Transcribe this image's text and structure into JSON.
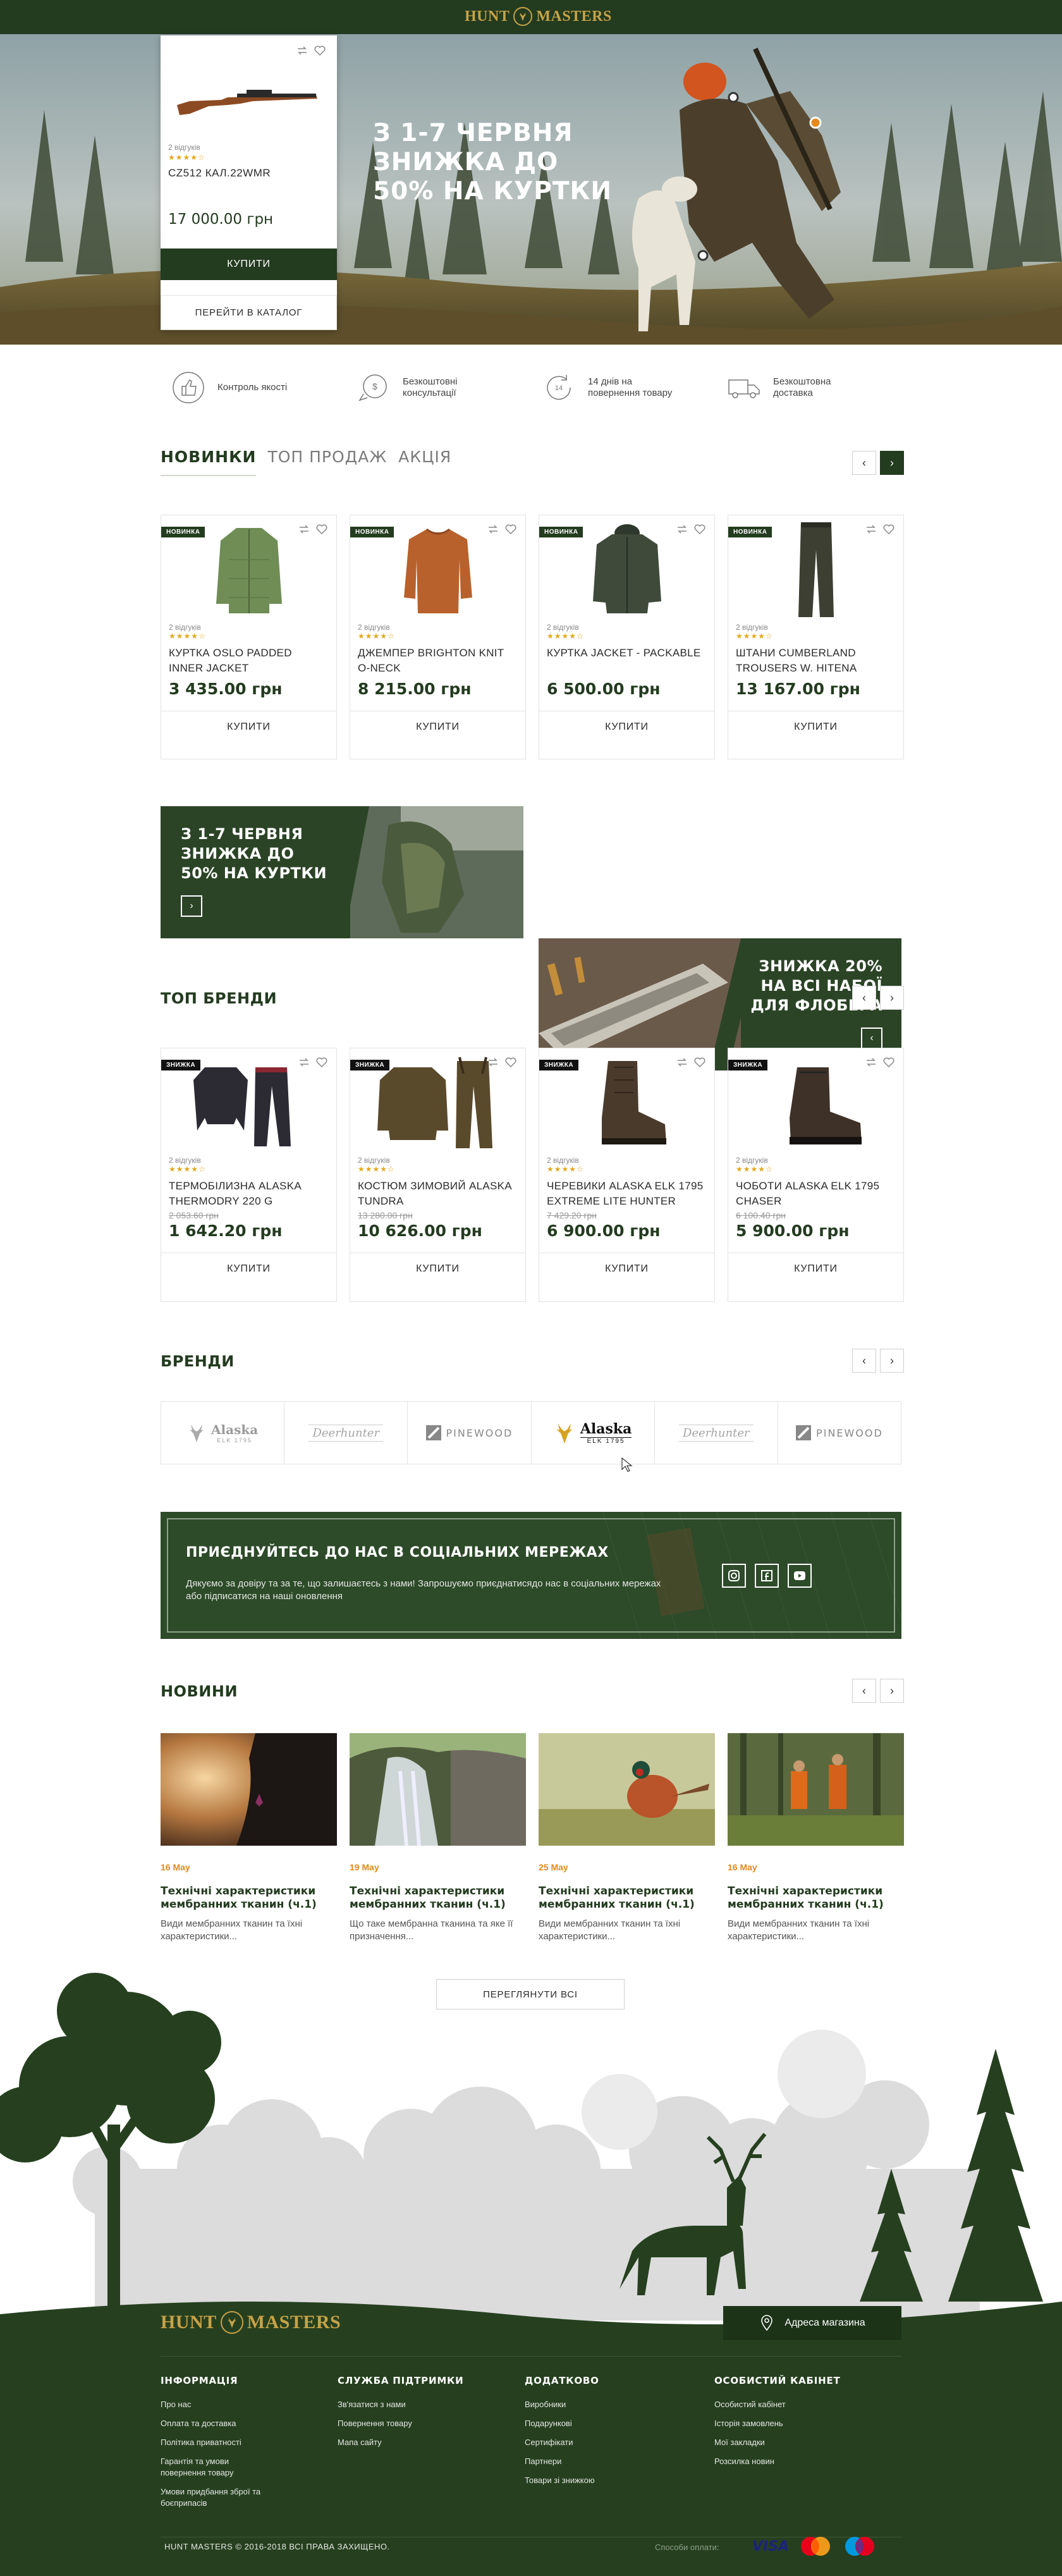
{
  "header": {
    "logo_left": "HUNT",
    "logo_right": "MASTERS"
  },
  "hero": {
    "title_lines": [
      "З 1-7 ЧЕРВНЯ",
      "ЗНИЖКА ДО",
      "50% НА КУРТКИ"
    ],
    "card": {
      "reviews": "2 відгуків",
      "name": "CZ512 КАЛ.22WMR",
      "price": "17 000.00 грн",
      "buy": "КУПИТИ",
      "catalog": "ПЕРЕЙТИ В КАТАЛОГ"
    }
  },
  "features": [
    {
      "icon": "thumbs-up-icon",
      "text": "Контроль якості"
    },
    {
      "icon": "consult-icon",
      "text": "Безкоштовні\nконсультації"
    },
    {
      "icon": "refresh-icon",
      "text": "14 днів на\nповернення товару"
    },
    {
      "icon": "truck-icon",
      "text": "Безкоштовна\nдоставка"
    }
  ],
  "new_section": {
    "tabs": [
      "НОВИНКИ",
      "ТОП ПРОДАЖ",
      "АКЦІЯ"
    ],
    "products": [
      {
        "badge": "НОВИНКА",
        "reviews": "2 відгуків",
        "name": "КУРТКА OSLO PADDED INNER JACKET",
        "price": "3 435.00 грн",
        "buy": "КУПИТИ",
        "color": "#6f8d55"
      },
      {
        "badge": "НОВИНКА",
        "reviews": "2 відгуків",
        "name": "ДЖЕМПЕР BRIGHTON KNIT O-NECK",
        "price": "8 215.00 грн",
        "buy": "КУПИТИ",
        "color": "#b8612c"
      },
      {
        "badge": "НОВИНКА",
        "reviews": "2 відгуків",
        "name": "КУРТКА JACKET - PACKABLE",
        "price": "6 500.00 грн",
        "buy": "КУПИТИ",
        "color": "#3f4a3b"
      },
      {
        "badge": "НОВИНКА",
        "reviews": "2 відгуків",
        "name": "ШТАНИ CUMBERLAND TROUSERS W. HITENA",
        "price": "13 167.00 грн",
        "buy": "КУПИТИ",
        "color": "#3e3f33"
      }
    ]
  },
  "banners": [
    {
      "text_lines": [
        "З 1-7 ЧЕРВНЯ",
        "ЗНИЖКА ДО",
        "50% НА КУРТКИ"
      ]
    },
    {
      "text_lines": [
        "ЗНИЖКА 20%",
        "НА ВСІ НАБОЇ",
        "ДЛЯ ФЛОБЕРА"
      ]
    }
  ],
  "top_brands": {
    "title": "ТОП БРЕНДИ",
    "products": [
      {
        "badge": "ЗНИЖКА",
        "reviews": "2 відгуків",
        "name": "ТЕРМОБІЛИЗНА ALASKA THERMODRY 220 G",
        "old_price": "2 053.60 грн",
        "price": "1 642.20 грн",
        "buy": "КУПИТИ",
        "color": "#2c2a33"
      },
      {
        "badge": "ЗНИЖКА",
        "reviews": "2 відгуків",
        "name": "КОСТЮМ ЗИМОВИЙ ALASKA TUNDRA",
        "old_price": "13 280.00 грн",
        "price": "10 626.00 грн",
        "buy": "КУПИТИ",
        "color": "#5a4a2c"
      },
      {
        "badge": "ЗНИЖКА",
        "reviews": "2 відгуків",
        "name": "ЧЕРЕВИКИ ALASKA ELK 1795 EXTREME LITE HUNTER",
        "old_price": "7 429.20 грн",
        "price": "6 900.00 грн",
        "buy": "КУПИТИ",
        "color": "#4a3a2c"
      },
      {
        "badge": "ЗНИЖКА",
        "reviews": "2 відгуків",
        "name": "ЧОБОТИ ALASKA ELK 1795 CHASER",
        "old_price": "6 100.40 грн",
        "price": "5 900.00 грн",
        "buy": "КУПИТИ",
        "color": "#3e3128"
      }
    ]
  },
  "brands": {
    "title": "БРЕНДИ",
    "items": [
      {
        "name": "Alaska",
        "sub": "ELK 1795",
        "style": "grey"
      },
      {
        "name": "Deerhunter",
        "sub": "",
        "style": "grey"
      },
      {
        "name": "PINEWOOD",
        "sub": "",
        "style": "grey"
      },
      {
        "name": "Alaska",
        "sub": "ELK 1795",
        "style": "gold"
      },
      {
        "name": "Deerhunter",
        "sub": "",
        "style": "grey"
      },
      {
        "name": "PINEWOOD",
        "sub": "",
        "style": "grey"
      }
    ]
  },
  "social": {
    "title": "ПРИЄДНУЙТЕСЬ ДО НАС  В СОЦІАЛЬНИХ МЕРЕЖАХ",
    "text": "Дякуємо за довіру та за те, що залишаєтесь з нами! Запрошуємо приєднатисядо нас в соціальних мережах або підписатися на наші оновлення"
  },
  "news": {
    "title": "НОВИНИ",
    "items": [
      {
        "date": "16 May",
        "title": "Технічні характеристики мембранних тканин (ч.1)",
        "text": "Види мембранних тканин та їхні характеристики..."
      },
      {
        "date": "19 May",
        "title": "Технічні характеристики мембранних тканин (ч.1)",
        "text": "Що таке мембранна тканина та яке її призначення..."
      },
      {
        "date": "25 May",
        "title": "Технічні характеристики мембранних тканин (ч.1)",
        "text": "Види мембранних тканин та їхні характеристики..."
      },
      {
        "date": "16 May",
        "title": "Технічні характеристики мембранних тканин (ч.1)",
        "text": "Види мембранних тканин та їхні характеристики..."
      }
    ],
    "view_all": "ПЕРЕГЛЯНУТИ ВСІ"
  },
  "footer": {
    "logo_left": "HUNT",
    "logo_right": "MASTERS",
    "address_button": "Адреса магазина",
    "columns": [
      {
        "title": "ІНФОРМАЦІЯ",
        "links": [
          "Про нас",
          "Оплата та доставка",
          "Політика приватності",
          "Гарантія та умови повернення товару",
          "Умови придбання зброї та боєприпасів"
        ]
      },
      {
        "title": "СЛУЖБА ПІДТРИМКИ",
        "links": [
          "Зв'язатися з нами",
          "Повернення товару",
          "Мапа сайту"
        ]
      },
      {
        "title": "ДОДАТКОВО",
        "links": [
          "Виробники",
          "Подарункові",
          "Сертифікати",
          "Партнери",
          "Товари зі знижкою"
        ]
      },
      {
        "title": "ОСОБИСТИЙ КАБІНЕТ",
        "links": [
          "Особистий кабінет",
          "Історія замовлень",
          "Мої закладки",
          "Розсилка новин"
        ]
      }
    ],
    "copyright": "HUNT MASTERS © 2016-2018 ВСІ ПРАВА ЗАХИЩЕНО.",
    "payments_label": "Способи оплати:",
    "payments": [
      "VISA",
      "Mastercard",
      "Maestro"
    ]
  },
  "colors": {
    "brand_green": "#233b1f",
    "accent_orange": "#e3891e",
    "gold": "#c7a247"
  }
}
